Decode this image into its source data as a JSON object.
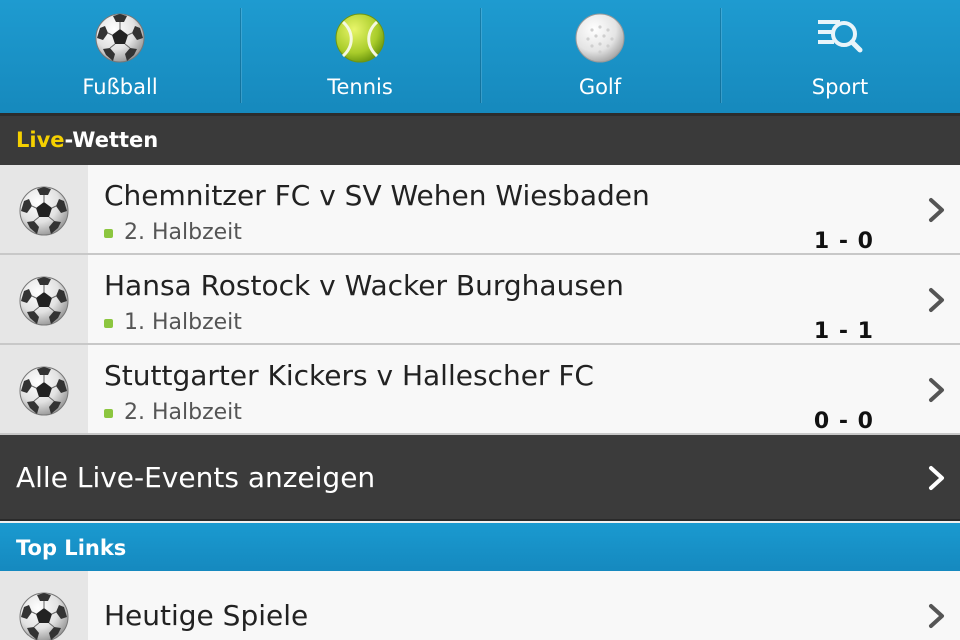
{
  "nav": {
    "items": [
      {
        "label": "Fußball",
        "icon": "football-icon"
      },
      {
        "label": "Tennis",
        "icon": "tennis-ball-icon"
      },
      {
        "label": "Golf",
        "icon": "golf-ball-icon"
      },
      {
        "label": "Sport",
        "icon": "search-list-icon"
      }
    ]
  },
  "live_section": {
    "title_accent": "Live",
    "title_rest": "-Wetten"
  },
  "events": [
    {
      "title": "Chemnitzer FC v SV Wehen Wiesbaden",
      "status": "2. Halbzeit",
      "score": "1 - 0"
    },
    {
      "title": "Hansa Rostock v Wacker Burghausen",
      "status": "1. Halbzeit",
      "score": "1 - 1"
    },
    {
      "title": "Stuttgarter Kickers v Hallescher FC",
      "status": "2. Halbzeit",
      "score": "0 - 0"
    }
  ],
  "all_live": {
    "label": "Alle Live-Events anzeigen"
  },
  "top_links": {
    "title": "Top Links",
    "items": [
      {
        "label": "Heutige Spiele",
        "icon": "football-icon"
      }
    ]
  },
  "colors": {
    "brand_blue": "#1a93c8",
    "live_yellow": "#f5d000",
    "live_dot": "#8cc63f",
    "dark_bar": "#3a3a3a"
  }
}
